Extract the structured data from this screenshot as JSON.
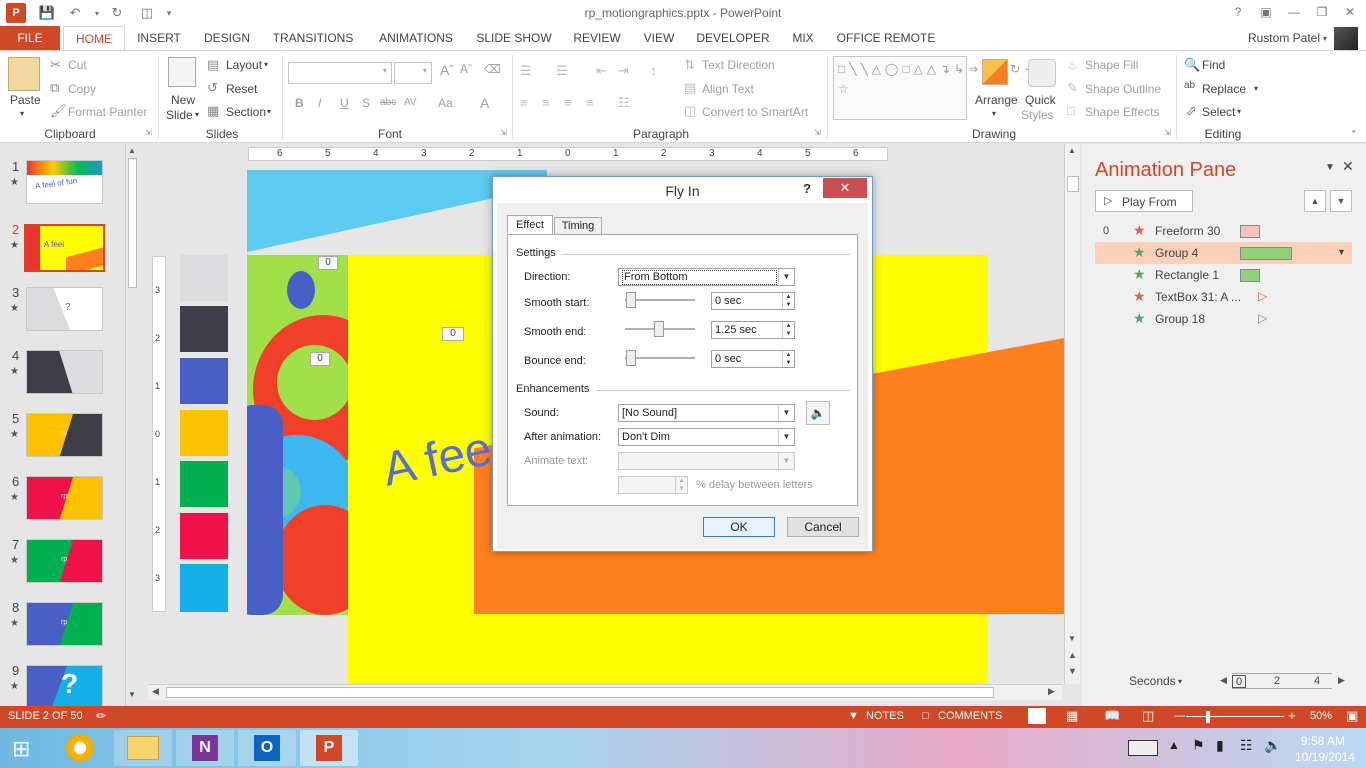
{
  "window": {
    "title": "rp_motiongraphics.pptx - PowerPoint",
    "help": "?"
  },
  "tabs": {
    "file": "FILE",
    "home": "HOME",
    "insert": "INSERT",
    "design": "DESIGN",
    "transitions": "TRANSITIONS",
    "animations": "ANIMATIONS",
    "slideshow": "SLIDE SHOW",
    "review": "REVIEW",
    "view": "VIEW",
    "developer": "DEVELOPER",
    "mix": "MIX",
    "officeremote": "OFFICE REMOTE"
  },
  "user": {
    "name": "Rustom Patel"
  },
  "ribbon": {
    "clipboard": {
      "paste": "Paste",
      "cut": "Cut",
      "copy": "Copy",
      "format_painter": "Format Painter",
      "label": "Clipboard"
    },
    "slides": {
      "new_slide_1": "New",
      "new_slide_2": "Slide",
      "layout": "Layout",
      "reset": "Reset",
      "section": "Section",
      "label": "Slides"
    },
    "font": {
      "label": "Font",
      "bold": "B",
      "italic": "I",
      "underline": "U",
      "strike": "S",
      "abc": "abc",
      "av": "AV",
      "aa": "Aa",
      "a": "A"
    },
    "paragraph": {
      "text_direction": "Text Direction",
      "align_text": "Align Text",
      "convert_smartart": "Convert to SmartArt",
      "label": "Paragraph"
    },
    "drawing": {
      "arrange": "Arrange",
      "quick_styles_1": "Quick",
      "quick_styles_2": "Styles",
      "shape_fill": "Shape Fill",
      "shape_outline": "Shape Outline",
      "shape_effects": "Shape Effects",
      "label": "Drawing"
    },
    "editing": {
      "find": "Find",
      "replace": "Replace",
      "select": "Select",
      "label": "Editing"
    }
  },
  "thumbnails": [
    {
      "num": "1",
      "text": "A feel of fun"
    },
    {
      "num": "2",
      "text": "A feel"
    },
    {
      "num": "3",
      "text": "?"
    },
    {
      "num": "4",
      "text": ""
    },
    {
      "num": "5",
      "text": "rp"
    },
    {
      "num": "6",
      "text": "rp"
    },
    {
      "num": "7",
      "text": "rp"
    },
    {
      "num": "8",
      "text": "rp"
    },
    {
      "num": "9",
      "text": "?"
    }
  ],
  "ruler": {
    "numbers": [
      "6",
      "5",
      "4",
      "3",
      "2",
      "1",
      "0",
      "1",
      "2",
      "3",
      "4",
      "5",
      "6"
    ],
    "vnumbers": [
      "3",
      "2",
      "1",
      "0",
      "1",
      "2",
      "3"
    ]
  },
  "slide": {
    "text": "A fee",
    "tag_a": "0",
    "tag_b": "0",
    "tag_c": "0"
  },
  "dialog": {
    "title": "Fly In",
    "help": "?",
    "tab_effect": "Effect",
    "tab_timing": "Timing",
    "settings": "Settings",
    "direction_label": "Direction:",
    "direction_value": "From Bottom",
    "smooth_start_label": "Smooth start:",
    "smooth_start_value": "0 sec",
    "smooth_end_label": "Smooth end:",
    "smooth_end_value": "1.25 sec",
    "bounce_end_label": "Bounce end:",
    "bounce_end_value": "0 sec",
    "enhancements": "Enhancements",
    "sound_label": "Sound:",
    "sound_value": "[No Sound]",
    "after_label": "After animation:",
    "after_value": "Don't Dim",
    "animate_text_label": "Animate text:",
    "delay_label": "% delay between letters",
    "ok": "OK",
    "cancel": "Cancel"
  },
  "anim_pane": {
    "title": "Animation Pane",
    "play_from": "Play From",
    "step_number": "0",
    "items": [
      {
        "name": "Freeform 30",
        "star_color": "#e06050",
        "bar_color": "#f8c0c0"
      },
      {
        "name": "Group 4",
        "star_color": "#58a070",
        "bar_color": "#92d07a"
      },
      {
        "name": "Rectangle 1",
        "star_color": "#58a070",
        "bar_color": "#92d07a"
      },
      {
        "name": "TextBox 31: A ...",
        "star_color": "#e06050",
        "bar_color": "#f8c0c0"
      },
      {
        "name": "Group 18",
        "star_color": "#58a070",
        "bar_color": "#92d07a"
      }
    ],
    "seconds": "Seconds",
    "scale": [
      "0",
      "2",
      "4"
    ]
  },
  "status": {
    "slide": "SLIDE 2 OF 50",
    "notes": "NOTES",
    "comments": "COMMENTS",
    "zoom": "50%"
  },
  "taskbar": {
    "time": "9:58 AM",
    "date": "10/19/2014"
  },
  "colors": {
    "accent": "#d24726",
    "yellow": "#ffff00",
    "orange": "#ff8020",
    "green_bar": "#92d07a",
    "pink_bar": "#f8c0c0"
  }
}
